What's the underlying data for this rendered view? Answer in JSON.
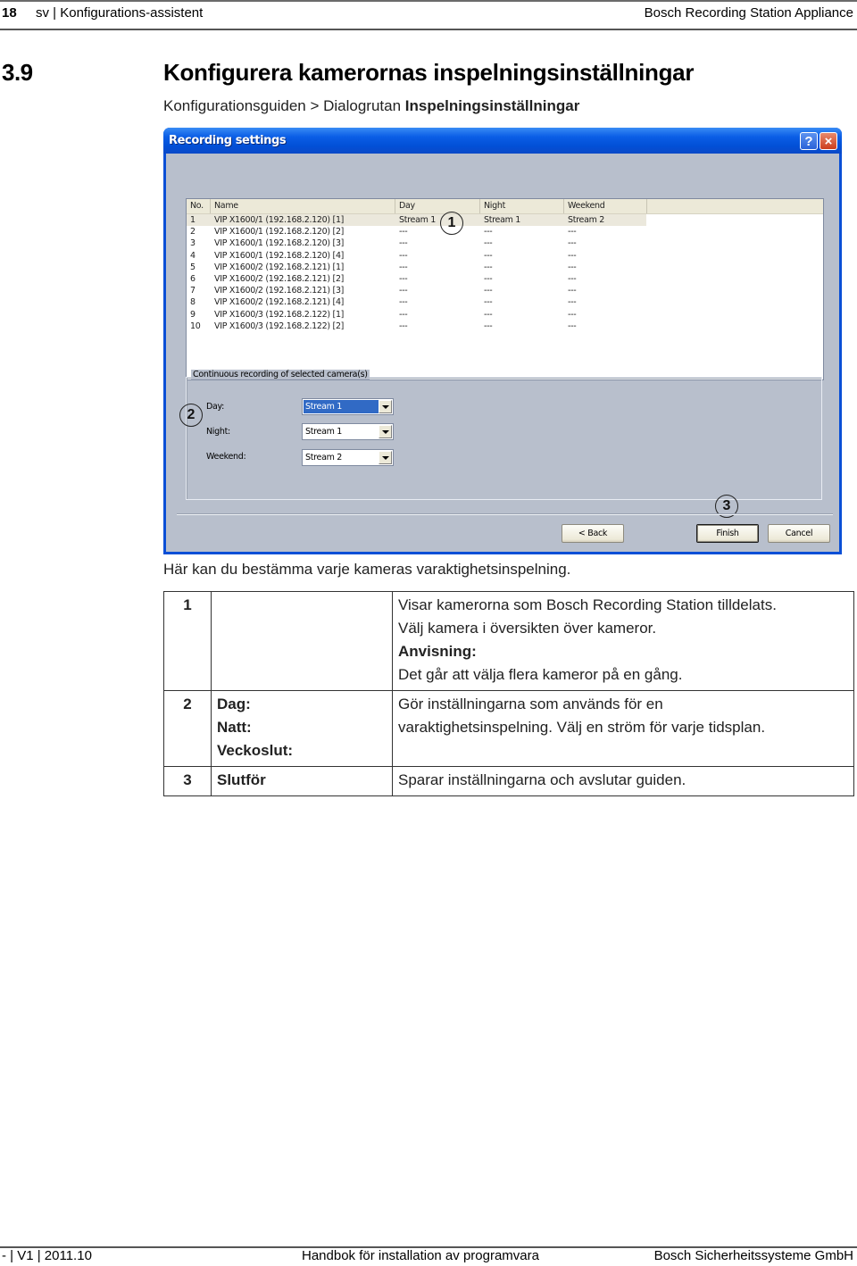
{
  "header": {
    "page_number": "18",
    "section": "sv | Konfigurations-assistent",
    "product": "Bosch Recording Station Appliance"
  },
  "section": {
    "number": "3.9",
    "title": "Konfigurera kamerornas inspelningsinställningar",
    "breadcrumb_prefix": "Konfigurationsguiden > Dialogrutan ",
    "breadcrumb_bold": "Inspelningsinställningar"
  },
  "dialog": {
    "title": "Recording settings",
    "help_button": "?",
    "close_button": "×",
    "list": {
      "columns": [
        "No.",
        "Name",
        "Day",
        "Night",
        "Weekend"
      ],
      "rows": [
        {
          "no": "1",
          "name": "VIP X1600/1 (192.168.2.120) [1]",
          "day": "Stream 1",
          "night": "Stream 1",
          "weekend": "Stream 2",
          "selected": true
        },
        {
          "no": "2",
          "name": "VIP X1600/1 (192.168.2.120) [2]",
          "day": "---",
          "night": "---",
          "weekend": "---"
        },
        {
          "no": "3",
          "name": "VIP X1600/1 (192.168.2.120) [3]",
          "day": "---",
          "night": "---",
          "weekend": "---"
        },
        {
          "no": "4",
          "name": "VIP X1600/1 (192.168.2.120) [4]",
          "day": "---",
          "night": "---",
          "weekend": "---"
        },
        {
          "no": "5",
          "name": "VIP X1600/2 (192.168.2.121) [1]",
          "day": "---",
          "night": "---",
          "weekend": "---"
        },
        {
          "no": "6",
          "name": "VIP X1600/2 (192.168.2.121) [2]",
          "day": "---",
          "night": "---",
          "weekend": "---"
        },
        {
          "no": "7",
          "name": "VIP X1600/2 (192.168.2.121) [3]",
          "day": "---",
          "night": "---",
          "weekend": "---"
        },
        {
          "no": "8",
          "name": "VIP X1600/2 (192.168.2.121) [4]",
          "day": "---",
          "night": "---",
          "weekend": "---"
        },
        {
          "no": "9",
          "name": "VIP X1600/3 (192.168.2.122) [1]",
          "day": "---",
          "night": "---",
          "weekend": "---"
        },
        {
          "no": "10",
          "name": "VIP X1600/3 (192.168.2.122) [2]",
          "day": "---",
          "night": "---",
          "weekend": "---"
        }
      ]
    },
    "group": {
      "legend": "Continuous recording of selected camera(s)",
      "fields": [
        {
          "label": "Day:",
          "value": "Stream 1",
          "focused": true
        },
        {
          "label": "Night:",
          "value": "Stream 1"
        },
        {
          "label": "Weekend:",
          "value": "Stream 2"
        }
      ]
    },
    "buttons": {
      "back": "< Back",
      "finish": "Finish",
      "cancel": "Cancel"
    },
    "callouts": [
      "1",
      "2",
      "3"
    ]
  },
  "intro": "Här kan du bestämma varje kameras varaktighetsinspelning.",
  "table": {
    "rows": [
      {
        "num": "1",
        "terms": [],
        "desc": [
          "Visar kamerorna som Bosch Recording Station tilldelats.",
          "Välj kamera i översikten över kameror."
        ],
        "note_label": "Anvisning:",
        "note": "Det går att välja flera kameror på en gång."
      },
      {
        "num": "2",
        "terms": [
          "Dag:",
          "Natt:",
          "Veckoslut:"
        ],
        "desc": [
          "Gör inställningarna som används för en varaktighetsinspelning. Välj en ström för varje tidsplan."
        ]
      },
      {
        "num": "3",
        "terms": [
          "Slutför"
        ],
        "desc": [
          "Sparar inställningarna och avslutar guiden."
        ]
      }
    ]
  },
  "footer": {
    "left": "- | V1 | 2011.10",
    "center": "Handbok för installation av programvara",
    "right": "Bosch Sicherheitssysteme GmbH"
  }
}
